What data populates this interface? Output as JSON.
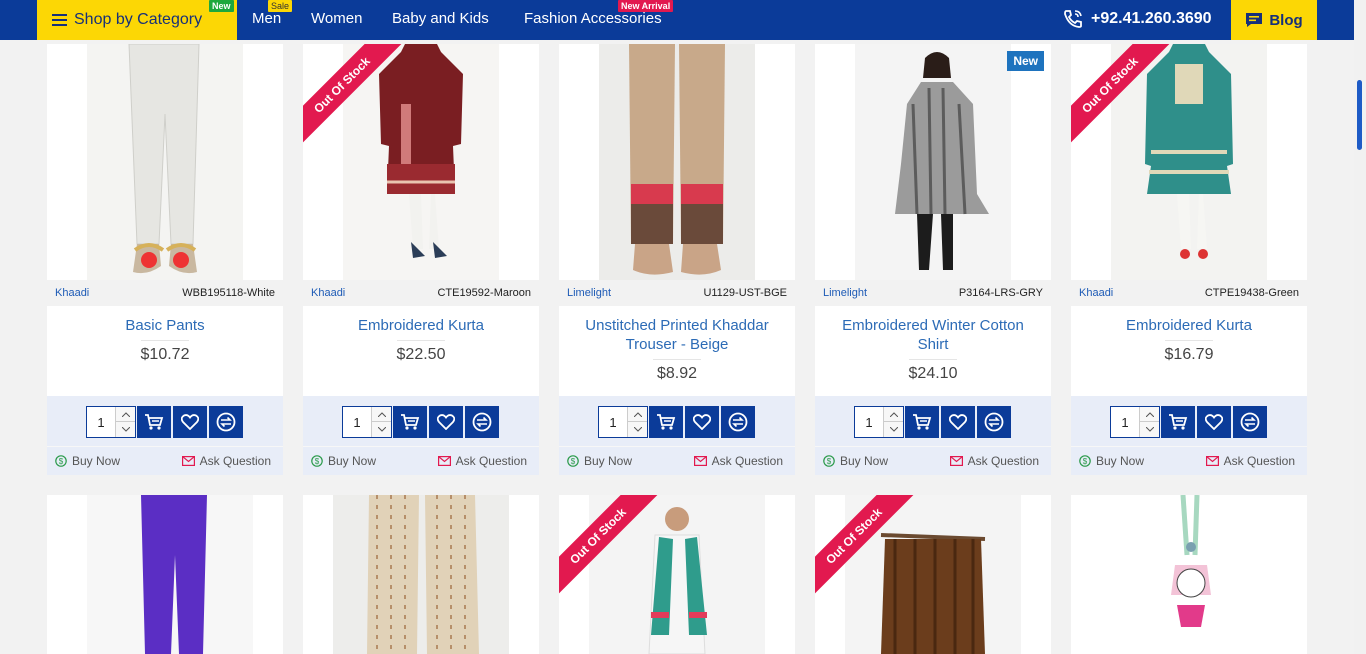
{
  "nav": {
    "shop_by_category": "Shop by Category",
    "badge_new": "New",
    "men": "Men",
    "badge_sale": "Sale",
    "women": "Women",
    "baby_kids": "Baby and Kids",
    "fashion_accessories": "Fashion Accessories",
    "badge_new_arrival": "New Arrival",
    "phone": "+92.41.260.3690",
    "blog": "Blog"
  },
  "labels": {
    "buy_now": "Buy Now",
    "ask_question": "Ask Question",
    "out_of_stock": "Out Of Stock",
    "new_tag": "New"
  },
  "colors": {
    "nav_bg": "#0b3b99",
    "accent_yellow": "#fcd705",
    "ribbon_red": "#e2194f",
    "link_blue": "#2c6bb6"
  },
  "products": [
    {
      "brand": "Khaadi",
      "sku": "WBB195118-White",
      "title": "Basic Pants",
      "price": "$10.72",
      "qty": "1",
      "out_of_stock": false,
      "is_new": false
    },
    {
      "brand": "Khaadi",
      "sku": "CTE19592-Maroon",
      "title": "Embroidered Kurta",
      "price": "$22.50",
      "qty": "1",
      "out_of_stock": true,
      "is_new": false
    },
    {
      "brand": "Limelight",
      "sku": "U1129-UST-BGE",
      "title": "Unstitched Printed Khaddar Trouser - Beige",
      "price": "$8.92",
      "qty": "1",
      "out_of_stock": false,
      "is_new": false
    },
    {
      "brand": "Limelight",
      "sku": "P3164-LRS-GRY",
      "title": "Embroidered Winter Cotton Shirt",
      "price": "$24.10",
      "qty": "1",
      "out_of_stock": false,
      "is_new": true
    },
    {
      "brand": "Khaadi",
      "sku": "CTPE19438-Green",
      "title": "Embroidered Kurta",
      "price": "$16.79",
      "qty": "1",
      "out_of_stock": true,
      "is_new": false
    }
  ],
  "row2": [
    {
      "out_of_stock": false
    },
    {
      "out_of_stock": false
    },
    {
      "out_of_stock": true
    },
    {
      "out_of_stock": true
    },
    {
      "out_of_stock": false
    }
  ]
}
